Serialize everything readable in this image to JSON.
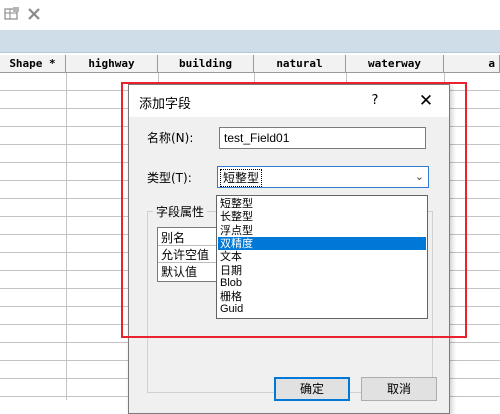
{
  "toolbar": {
    "icons": [
      "table-icon",
      "close-icon"
    ]
  },
  "grid": {
    "columns": [
      "Shape *",
      "highway",
      "building",
      "natural",
      "waterway",
      "a"
    ]
  },
  "dialog": {
    "title": "添加字段",
    "help_label": "?",
    "close_label": "✕",
    "name_label": "名称(N):",
    "name_value": "test_Field01",
    "type_label": "类型(T):",
    "type_value": "短整型",
    "field_props_label": "字段属性",
    "field_props": [
      "别名",
      "允许空值",
      "默认值"
    ],
    "ok_label": "确定",
    "cancel_label": "取消"
  },
  "dropdown": {
    "items": [
      "短整型",
      "长整型",
      "浮点型",
      "双精度",
      "文本",
      "日期",
      "Blob",
      "栅格",
      "Guid"
    ],
    "selected_index": 3
  },
  "colors": {
    "highlight_box": "#e8232b",
    "selection": "#0078d7",
    "header_band": "#cfdde9"
  }
}
